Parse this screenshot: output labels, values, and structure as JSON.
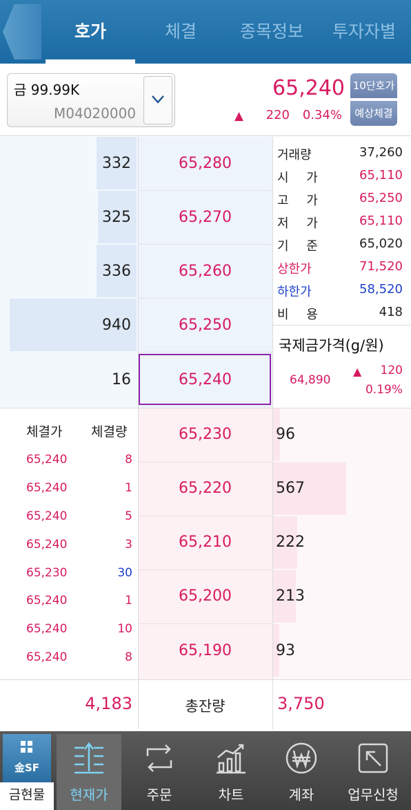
{
  "header": {
    "tabs": [
      {
        "label": "호가",
        "active": true
      },
      {
        "label": "체결",
        "active": false
      },
      {
        "label": "종목정보",
        "active": false
      },
      {
        "label": "투자자별",
        "active": false
      }
    ]
  },
  "stock": {
    "name": "금 99.99K",
    "code": "M04020000",
    "current_price": "65,240",
    "change_symbol": "▲",
    "change": "220",
    "change_pct": "0.34%"
  },
  "buttons": {
    "ten_level": "10단호가",
    "expected": "예상체결"
  },
  "asks": [
    {
      "price": "65,280",
      "qty": "332"
    },
    {
      "price": "65,270",
      "qty": "325"
    },
    {
      "price": "65,260",
      "qty": "336"
    },
    {
      "price": "65,250",
      "qty": "940"
    },
    {
      "price": "65,240",
      "qty": "16"
    }
  ],
  "bids": [
    {
      "price": "65,230",
      "qty": "96"
    },
    {
      "price": "65,220",
      "qty": "567"
    },
    {
      "price": "65,210",
      "qty": "222"
    },
    {
      "price": "65,200",
      "qty": "213"
    },
    {
      "price": "65,190",
      "qty": "93"
    }
  ],
  "stats": [
    {
      "label": "거래량",
      "value": "37,260"
    },
    {
      "label": "시 가",
      "value": "65,110"
    },
    {
      "label": "고 가",
      "value": "65,250"
    },
    {
      "label": "저 가",
      "value": "65,110"
    },
    {
      "label": "기 준",
      "value": "65,020"
    },
    {
      "label": "상한가",
      "value": "71,520"
    },
    {
      "label": "하한가",
      "value": "58,520"
    },
    {
      "label": "비 용",
      "value": "418"
    }
  ],
  "intl_gold": {
    "title": "국제금가격(g/원)",
    "price": "64,890",
    "change_symbol": "▲",
    "change": "120",
    "change_pct": "0.19%"
  },
  "trades": {
    "price_header": "체결가",
    "volume_header": "체결량",
    "rows": [
      {
        "price": "65,240",
        "volume": "8"
      },
      {
        "price": "65,240",
        "volume": "1"
      },
      {
        "price": "65,240",
        "volume": "5"
      },
      {
        "price": "65,240",
        "volume": "3"
      },
      {
        "price": "65,230",
        "volume": "30"
      },
      {
        "price": "65,240",
        "volume": "1"
      },
      {
        "price": "65,240",
        "volume": "10"
      },
      {
        "price": "65,240",
        "volume": "8"
      }
    ]
  },
  "totals": {
    "ask_total": "4,183",
    "label": "총잔량",
    "bid_total": "3,750"
  },
  "nav": {
    "logo_text": "金SF",
    "logo_label": "금현물",
    "items": [
      {
        "label": "현재가",
        "icon": "price-list-icon",
        "active": true
      },
      {
        "label": "주문",
        "icon": "exchange-icon",
        "active": false
      },
      {
        "label": "차트",
        "icon": "chart-icon",
        "active": false
      },
      {
        "label": "계좌",
        "icon": "won-icon",
        "active": false
      },
      {
        "label": "업무신청",
        "icon": "request-icon",
        "active": false
      }
    ]
  },
  "colors": {
    "up": "#d81b60",
    "down": "#1e40c8",
    "header": "#1b6aa3",
    "current_border": "#8e24aa"
  }
}
